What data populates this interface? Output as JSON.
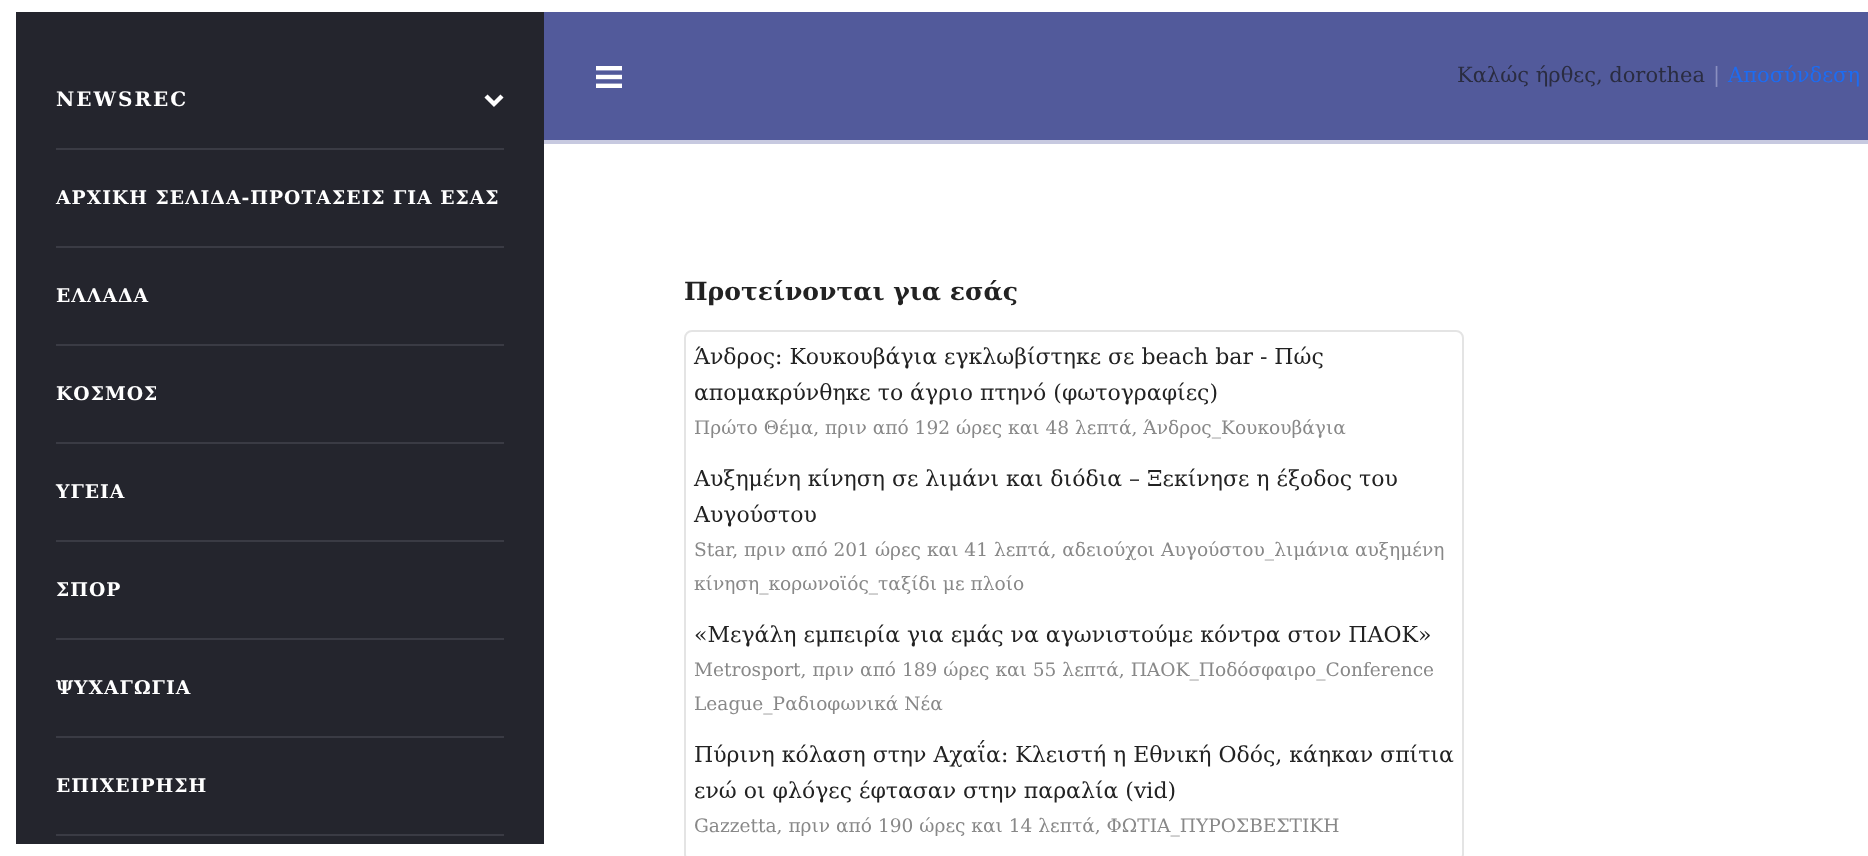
{
  "sidebar": {
    "brand": "NEWSREC",
    "items": [
      {
        "label": "ΑΡΧΙΚΗ ΣΕΛΙΔΑ-ΠΡΟΤΑΣΕΙΣ ΓΙΑ ΕΣΑΣ"
      },
      {
        "label": "ΕΛΛΑΔΑ"
      },
      {
        "label": "ΚΟΣΜΟΣ"
      },
      {
        "label": "ΥΓΕΙΑ"
      },
      {
        "label": "ΣΠΟΡ"
      },
      {
        "label": "ΨΥΧΑΓΩΓΙΑ"
      },
      {
        "label": "ΕΠΙΧΕΙΡΗΣΗ"
      }
    ]
  },
  "header": {
    "greeting": "Καλώς ήρθες, dorothea",
    "separator": "|",
    "logout": "Αποσύνδεση"
  },
  "section_title": "Προτείνονται για εσάς",
  "articles": [
    {
      "title": "Άνδρος: Κουκουβάγια εγκλωβίστηκε σε beach bar - Πώς απομακρύνθηκε το άγριο πτηνό (φωτογραφίες)",
      "meta": "Πρώτο Θέμα, πριν από 192 ώρες και 48 λεπτά, Άνδρος_Κουκουβάγια"
    },
    {
      "title": "Αυξημένη κίνηση σε λιμάνι και διόδια – Ξεκίνησε η έξοδος του Αυγούστου",
      "meta": "Star, πριν από 201 ώρες και 41 λεπτά, αδειούχοι Αυγούστου_λιμάνια αυξημένη κίνηση_κορωνοϊός_ταξίδι με πλοίο"
    },
    {
      "title": "«Μεγάλη εμπειρία για εμάς να αγωνιστούμε κόντρα στον ΠΑΟΚ»",
      "meta": "Metrosport, πριν από 189 ώρες και 55 λεπτά, ΠΑΟΚ_Ποδόσφαιρο_Conference League_Ραδιοφωνικά Νέα"
    },
    {
      "title": "Πύρινη κόλαση στην Αχαΐα: Κλειστή η Εθνική Οδός, κάηκαν σπίτια ενώ οι φλόγες έφτασαν στην παραλία (vid)",
      "meta": "Gazzetta, πριν από 190 ώρες και 14 λεπτά, ΦΩΤΙΑ_ΠΥΡΟΣΒΕΣΤΙΚΗ"
    }
  ]
}
